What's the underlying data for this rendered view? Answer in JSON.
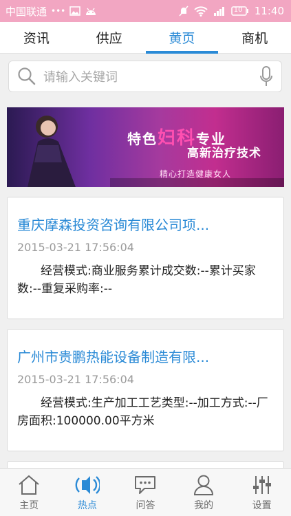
{
  "statusbar": {
    "carrier": "中国联通",
    "dots": "•••",
    "battery": "10",
    "time": "11:40"
  },
  "tabs": [
    {
      "label": "资讯",
      "active": false
    },
    {
      "label": "供应",
      "active": false
    },
    {
      "label": "黄页",
      "active": true
    },
    {
      "label": "商机",
      "active": false
    }
  ],
  "search": {
    "placeholder": "请输入关键词"
  },
  "banner": {
    "line1a": "特色",
    "line1b": "妇科",
    "line1c": "专业",
    "line2": "高新治疗技术",
    "line3": "精心打造健康女人"
  },
  "listings": [
    {
      "title": "重庆摩森投资咨询有限公司项...",
      "time": "2015-03-21 17:56:04",
      "desc": "经营模式:商业服务累计成交数:--累计买家数:--重复采购率:--"
    },
    {
      "title": "广州市贵鹏热能设备制造有限...",
      "time": "2015-03-21 17:56:04",
      "desc": "经营模式:生产加工工艺类型:--加工方式:--厂房面积:100000.00平方米"
    }
  ],
  "nav": [
    {
      "label": "主页",
      "icon": "home-icon",
      "active": false
    },
    {
      "label": "热点",
      "icon": "broadcast-icon",
      "active": true
    },
    {
      "label": "问答",
      "icon": "chat-icon",
      "active": false
    },
    {
      "label": "我的",
      "icon": "user-icon",
      "active": false
    },
    {
      "label": "设置",
      "icon": "sliders-icon",
      "active": false
    }
  ],
  "colors": {
    "accent": "#2a8ad6",
    "statusbar": "#f2a6c2"
  }
}
